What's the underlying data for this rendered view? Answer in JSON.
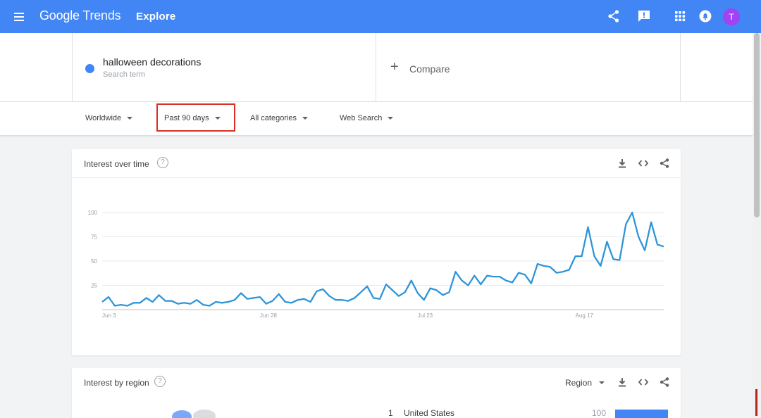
{
  "header": {
    "logo_google": "Google",
    "logo_trends": "Trends",
    "page": "Explore",
    "avatar_initial": "T"
  },
  "search": {
    "term": "halloween decorations",
    "term_type": "Search term",
    "compare_label": "Compare",
    "term_color": "#4285f4"
  },
  "filters": {
    "region": "Worldwide",
    "time": "Past 90 days",
    "category": "All categories",
    "search_type": "Web Search"
  },
  "interest_over_time": {
    "title": "Interest over time",
    "help": "?"
  },
  "interest_by_region": {
    "title": "Interest by region",
    "help": "?",
    "resolution": "Region",
    "rows": [
      {
        "rank": "1",
        "name": "United States",
        "value": "100"
      }
    ]
  },
  "colors": {
    "brand_blue": "#4285f4",
    "series_blue": "#2d95d8",
    "highlight_red": "#d93025",
    "avatar_purple": "#a142f4"
  },
  "chart_data": {
    "type": "line",
    "x_labels": [
      "Jun 3",
      "Jun 28",
      "Jul 23",
      "Aug 17"
    ],
    "x_label_index": [
      0,
      25,
      50,
      75
    ],
    "y_ticks": [
      25,
      50,
      75,
      100
    ],
    "ylim": [
      0,
      100
    ],
    "grid": true,
    "series": [
      {
        "values": [
          8,
          13,
          4,
          5,
          4,
          7,
          7,
          12,
          8,
          15,
          9,
          9,
          6,
          7,
          6,
          10,
          5,
          4,
          8,
          7,
          8,
          10,
          17,
          11,
          12,
          13,
          6,
          9,
          16,
          8,
          7,
          10,
          11,
          8,
          19,
          21,
          14,
          10,
          10,
          9,
          12,
          18,
          24,
          12,
          11,
          26,
          20,
          14,
          18,
          30,
          17,
          10,
          22,
          20,
          15,
          18,
          39,
          30,
          25,
          35,
          26,
          35,
          34,
          34,
          30,
          28,
          38,
          36,
          27,
          47,
          45,
          44,
          38,
          39,
          41,
          55,
          55,
          85,
          55,
          45,
          70,
          52,
          51,
          88,
          100,
          75,
          61,
          90,
          67,
          65
        ]
      }
    ]
  }
}
